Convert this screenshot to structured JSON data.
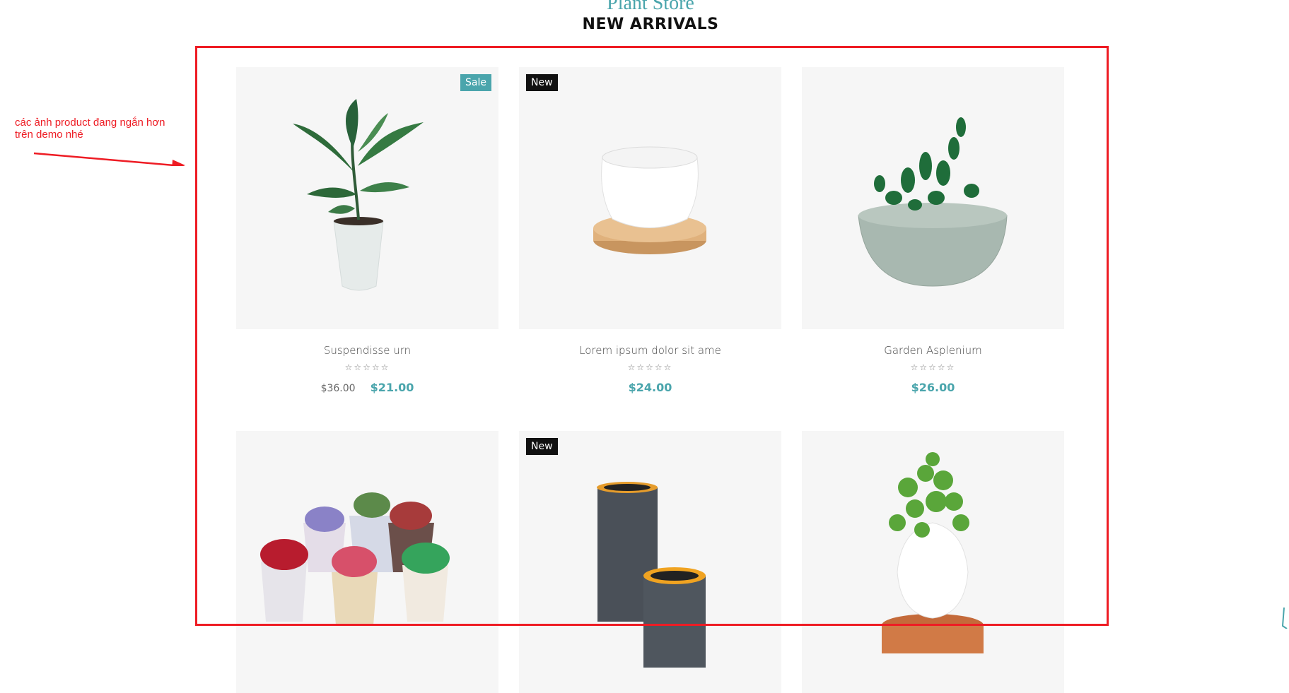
{
  "header": {
    "store_title": "Plant Store",
    "section_title": "NEW ARRIVALS"
  },
  "annotation": {
    "text": "các ảnh product đang ngắn hơn trên demo nhé",
    "color": "#ee1c24"
  },
  "colors": {
    "accent": "#4aa5ac",
    "new_badge": "#111111",
    "image_bg": "#f6f6f6"
  },
  "products": [
    {
      "name": "Suspendisse urn",
      "badge": "Sale",
      "old_price": "$36.00",
      "price": "$21.00",
      "rating": "☆☆☆☆☆",
      "image": "potted-plant-white-pot"
    },
    {
      "name": "Lorem ipsum dolor sit ame",
      "badge": "New",
      "old_price": "",
      "price": "$24.00",
      "rating": "☆☆☆☆☆",
      "image": "white-ceramic-pot-wood-tray"
    },
    {
      "name": "Garden Asplenium",
      "badge": "",
      "old_price": "",
      "price": "$26.00",
      "rating": "☆☆☆☆☆",
      "image": "succulent-concrete-bowl"
    },
    {
      "name": "",
      "badge": "",
      "old_price": "",
      "price": "",
      "rating": "",
      "image": "succulent-pots-group"
    },
    {
      "name": "",
      "badge": "New",
      "old_price": "",
      "price": "",
      "rating": "",
      "image": "grey-cylinder-planters"
    },
    {
      "name": "",
      "badge": "",
      "old_price": "",
      "price": "",
      "rating": "",
      "image": "herb-egg-pot-terracotta"
    }
  ]
}
